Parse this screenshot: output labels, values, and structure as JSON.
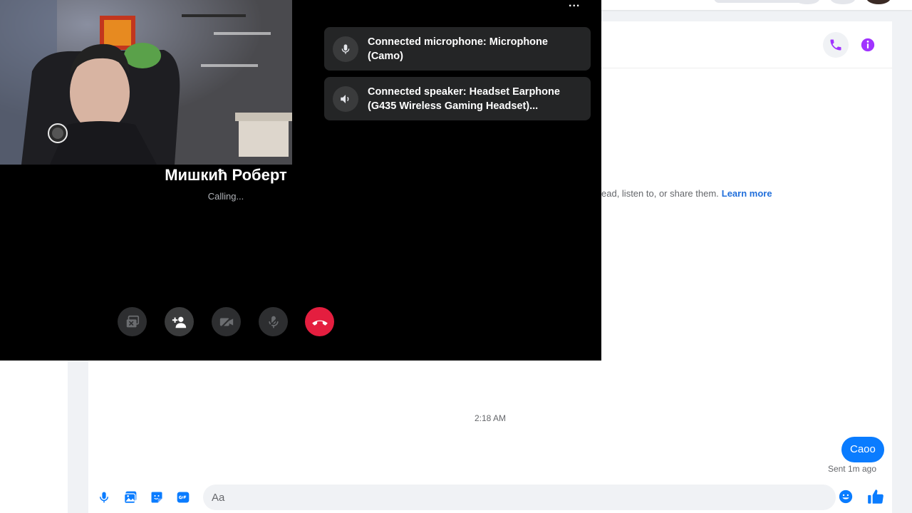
{
  "chat": {
    "notice_text": "ead, listen to, or share them.",
    "learn_more": "Learn more",
    "timestamp": "2:18 AM",
    "message": "Caoo",
    "sent_status": "Sent 1m ago",
    "composer_placeholder": "Aa"
  },
  "call": {
    "callee_name": "Мишкић Роберт",
    "status": "Calling...",
    "menu": "...",
    "toasts": [
      {
        "icon": "microphone-icon",
        "line1": "Connected microphone: Microphone",
        "line2": "(Camo)"
      },
      {
        "icon": "speaker-icon",
        "line1": "Connected speaker: Headset Earphone",
        "line2": "(G435 Wireless Gaming Headset)..."
      }
    ],
    "controls": [
      "screen-share-icon",
      "add-person-icon",
      "camera-off-icon",
      "mic-muted-icon",
      "end-call-icon"
    ]
  },
  "colors": {
    "accent": "#0a7cff",
    "purple": "#a033ff",
    "end_call": "#e41e3f",
    "link": "#216fdb"
  }
}
